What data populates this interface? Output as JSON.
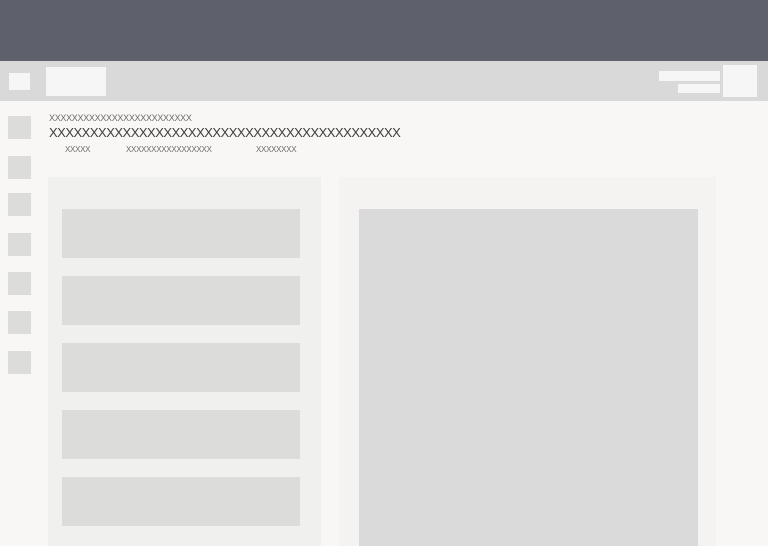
{
  "toolbar": {},
  "rail": {
    "items": [
      {
        "id": "item-1"
      },
      {
        "id": "item-2"
      },
      {
        "id": "item-3"
      },
      {
        "id": "item-4"
      },
      {
        "id": "item-5"
      },
      {
        "id": "item-6"
      },
      {
        "id": "item-7"
      }
    ]
  },
  "header": {
    "breadcrumb": "XXXXXXXXXXXXXXXXXXXXXXXXX",
    "title": "XXXXXXXXXXXXXXXXXXXXXXXXXXXXXXXXXXXXXXXXXXX",
    "meta": [
      "XXXXX",
      "XXXXXXXXXXXXXXXXX",
      "XXXXXXXX"
    ]
  },
  "list": {
    "cards": [
      {
        "id": "card-1"
      },
      {
        "id": "card-2"
      },
      {
        "id": "card-3"
      },
      {
        "id": "card-4"
      },
      {
        "id": "card-5"
      }
    ]
  }
}
